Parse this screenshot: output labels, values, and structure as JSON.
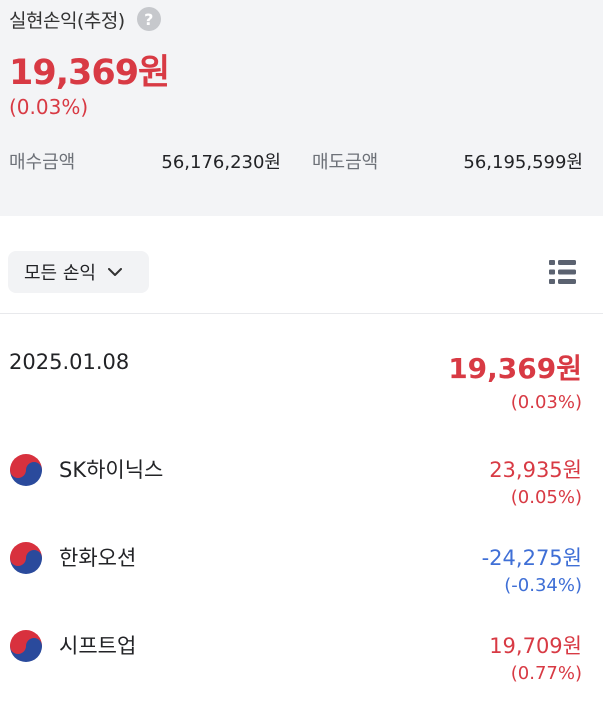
{
  "summary": {
    "title": "실현손익(추정)",
    "help_glyph": "?",
    "amount": "19,369원",
    "rate": "(0.03%)",
    "buy_label": "매수금액",
    "buy_value": "56,176,230원",
    "sell_label": "매도금액",
    "sell_value": "56,195,599원"
  },
  "filter": {
    "label": "모든 손익"
  },
  "day": {
    "date": "2025.01.08",
    "amount": "19,369원",
    "rate": "(0.03%)"
  },
  "stocks": [
    {
      "name": "SK하이닉스",
      "amount": "23,935원",
      "rate": "(0.05%)",
      "direction": "positive"
    },
    {
      "name": "한화오션",
      "amount": "-24,275원",
      "rate": "(-0.34%)",
      "direction": "negative"
    },
    {
      "name": "시프트업",
      "amount": "19,709원",
      "rate": "(0.77%)",
      "direction": "positive"
    }
  ],
  "icons": {
    "help": "question-circle-icon",
    "filter_caret": "chevron-down-icon",
    "view_toggle": "list-view-icon",
    "stock_flag": "korea-flag-icon"
  },
  "colors": {
    "profit": "#d83a44",
    "loss": "#3f6fd6",
    "summary_bg": "#f3f4f6",
    "text": "#222326"
  }
}
